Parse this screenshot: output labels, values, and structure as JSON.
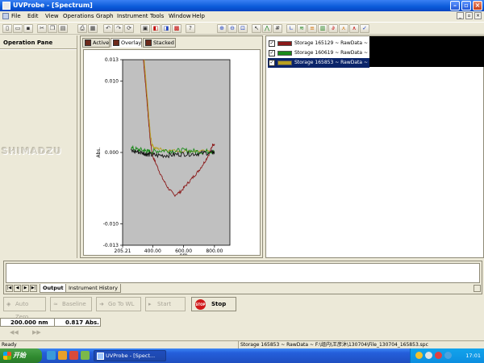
{
  "window": {
    "title": "UVProbe - [Spectrum]"
  },
  "menu": [
    "File",
    "Edit",
    "View",
    "Operations",
    "Graph",
    "Instrument",
    "Tools",
    "Window",
    "Help"
  ],
  "operation_pane": {
    "title": "Operation Pane",
    "logo": "SHIMADZU"
  },
  "graph": {
    "tabs": [
      "Active",
      "Overlay",
      "Stacked"
    ],
    "active_tab": "Overlay"
  },
  "chart_data": {
    "type": "line",
    "ylabel": "Abs.",
    "xlabel": "nm.",
    "xlim": [
      205.21,
      900
    ],
    "ylim": [
      -0.013,
      0.013
    ],
    "x_ticks": [
      205.21,
      400.0,
      600.0,
      800.0
    ],
    "x_tick_labels": [
      "205.21",
      "400.00",
      "600.00",
      "800.00"
    ],
    "y_ticks": [
      0.013,
      0.01,
      0.0,
      -0.01,
      -0.013
    ],
    "y_tick_labels": [
      "0.013",
      "0.010",
      "0.000",
      "-0.010",
      "-0.013"
    ],
    "plot_background": "#c0c0c0",
    "series": [
      {
        "color": "#8b1a1a",
        "x": [
          340,
          360,
          375,
          385,
          400,
          430,
          460,
          500,
          540,
          580,
          620,
          660,
          700,
          740,
          770,
          790,
          800
        ],
        "y": [
          0.013,
          0.008,
          0.004,
          0.0015,
          -0.0005,
          -0.002,
          -0.0035,
          -0.005,
          -0.006,
          -0.0055,
          -0.0045,
          -0.0035,
          -0.0025,
          -0.0012,
          0.0,
          0.0012,
          0.001
        ]
      },
      {
        "color": "#b8a020",
        "x": [
          345,
          360,
          375,
          385,
          395,
          410,
          450,
          500,
          600,
          700,
          800
        ],
        "y": [
          0.013,
          0.009,
          0.005,
          0.0025,
          0.0012,
          0.0006,
          0.0005,
          0.0003,
          0.0002,
          0.0002,
          0.0001
        ]
      },
      {
        "color": "#1a8a1a",
        "x": [
          260,
          300,
          340,
          360,
          380,
          420,
          480,
          540,
          600,
          660,
          720,
          780,
          800
        ],
        "y": [
          0.0006,
          0.0004,
          0.0003,
          0.0002,
          0.0001,
          0.0002,
          0.0003,
          0.0002,
          0.0003,
          0.0002,
          0.0001,
          0.0002,
          0.0001
        ]
      },
      {
        "color": "#111111",
        "x": [
          260,
          300,
          340,
          360,
          380,
          420,
          480,
          540,
          600,
          660,
          720,
          780,
          800
        ],
        "y": [
          0.0002,
          0.0001,
          -0.0001,
          -0.0002,
          -0.0003,
          -0.0004,
          -0.0004,
          -0.0003,
          -0.0002,
          -0.0002,
          -0.0001,
          0.0,
          0.0
        ]
      }
    ]
  },
  "samples": [
    {
      "label": "Storage 165129 ~ RawData ~",
      "checked": true,
      "color": "#8b1a1a",
      "selected": false
    },
    {
      "label": "Storage 160619 ~ RawData ~",
      "checked": true,
      "color": "#1a8a1a",
      "selected": false
    },
    {
      "label": "Storage 165853 ~ RawData ~",
      "checked": true,
      "color": "#b8a020",
      "selected": true
    }
  ],
  "output": {
    "tabs": [
      "Output",
      "Instrument History"
    ]
  },
  "controls": {
    "auto_zero": "Auto Zero",
    "baseline": "Baseline",
    "go_to_wl": "Go To WL",
    "start": "Start",
    "stop": "Stop",
    "stop_icon_text": "STOP"
  },
  "readout": {
    "wavelength": "200.000 nm",
    "abs": "0.817 Abs."
  },
  "status": {
    "ready": "Ready",
    "path": "Storage 165853 ~ RawData ~ F:\\组内\\王彦沐\\130704\\File_130704_165853.spc"
  },
  "taskbar": {
    "start": "开始",
    "task": "UVProbe - [Spect...",
    "clock": "17:01"
  }
}
